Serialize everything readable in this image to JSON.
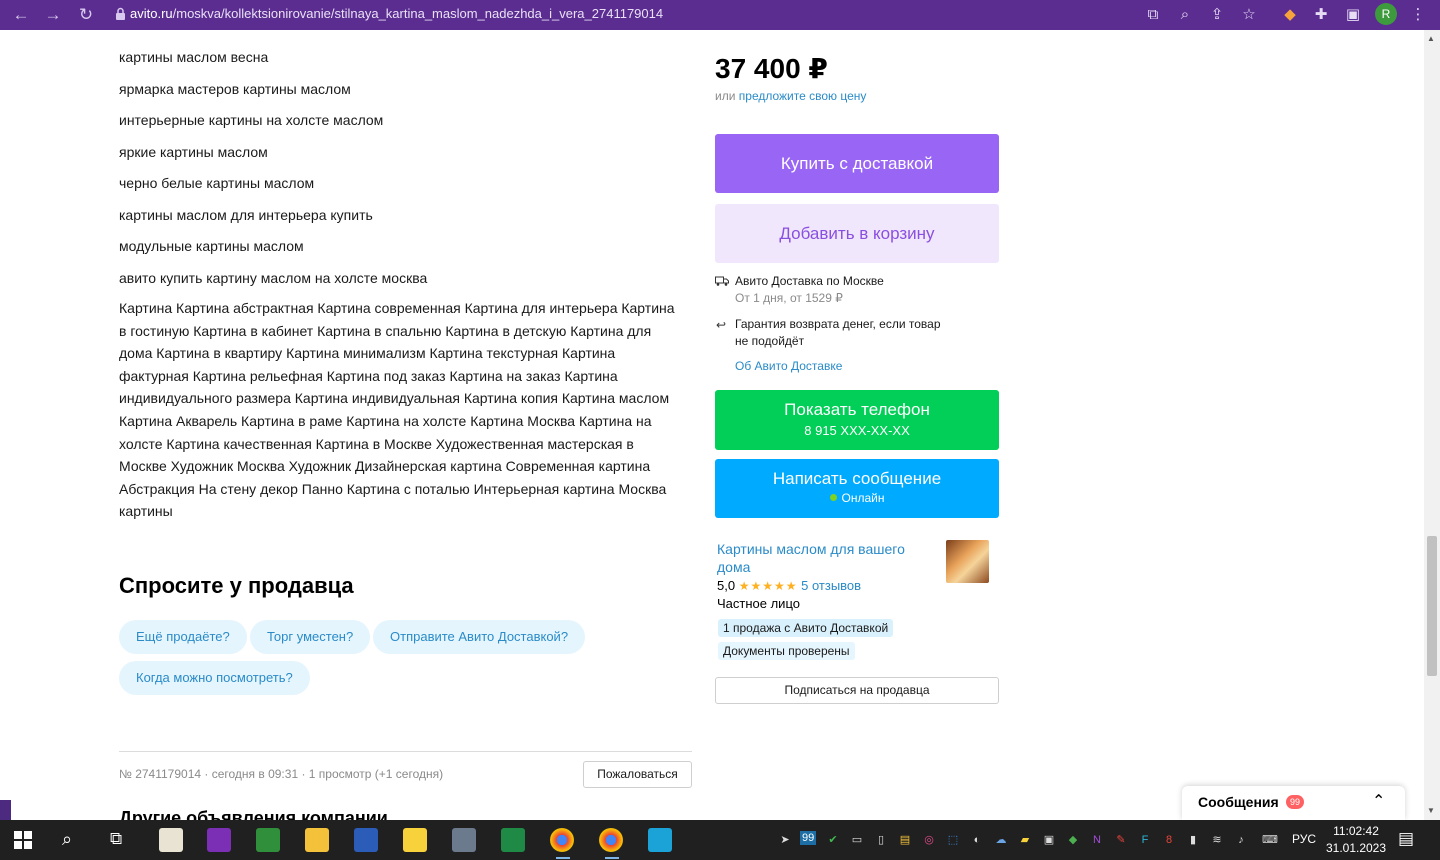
{
  "browser": {
    "url_host": "avito.ru",
    "url_path": "/moskva/kollektsionirovanie/stilnaya_kartina_maslom_nadezhda_i_vera_2741179014",
    "profile_initial": "R"
  },
  "tags": [
    "картины маслом весна",
    "ярмарка мастеров картины маслом",
    "интерьерные картины на холсте маслом",
    "яркие картины маслом",
    "черно белые картины маслом",
    "картины маслом для интерьера купить",
    "модульные картины маслом",
    "авито купить картину маслом на холсте москва"
  ],
  "description_lines": [
    "Картина Картина абстрактная Картина современная Картина для интерьера Картина",
    "в гостиную Картина в кабинет Картина в спальню Картина в детскую Картина для",
    "дома Картина в квартиру Картина минимализм Картина текстурная Картина",
    "фактурная Картина рельефная Картина под заказ Картина на заказ Картина",
    "индивидуального размера Картина индивидуальная Картина копия Картина маслом",
    "Картина Акварель Картина в раме Картина на холсте Картина Москва Картина на",
    "холсте Картина качественная Картина в Москве Художественная мастерская в",
    "Москве Художник Москва Художник Дизайнерская картина Современная картина",
    "Абстракция На стену декор Панно Картина с поталью Интерьерная картина Москва",
    "картины"
  ],
  "ask": {
    "title": "Спросите у продавца",
    "chips": [
      "Ещё продаёте?",
      "Торг уместен?",
      "Отправите Авито Доставкой?",
      "Когда можно посмотреть?"
    ]
  },
  "meta": {
    "text": "№ 2741179014 · сегодня в 09:31 · 1 просмотр (+1 сегодня)",
    "complain": "Пожаловаться"
  },
  "other_title": "Другие объявления компании",
  "sidebar": {
    "price": "37 400 ₽",
    "offer_prefix": "или",
    "offer_link": "предложите свою цену",
    "buy_label": "Купить с доставкой",
    "cart_label": "Добавить в корзину",
    "delivery_title": "Авито Доставка по Москве",
    "delivery_sub": "От 1 дня, от 1529 ₽",
    "guarantee_line1": "Гарантия возврата денег, если товар",
    "guarantee_line2": "не подойдёт",
    "about_delivery": "Об Авито Доставке",
    "phone_label": "Показать телефон",
    "phone_number": "8 915 XXX-XX-XX",
    "message_label": "Написать сообщение",
    "online": "Онлайн",
    "seller_name": "Картины маслом для вашего дома",
    "rating": "5,0",
    "stars": "★★★★★",
    "reviews": "5 отзывов",
    "seller_type": "Частное лицо",
    "badge_sales": "1 продажа с Авито Доставкой",
    "badge_docs": "Документы проверены",
    "subscribe": "Подписаться на продавца"
  },
  "messages_panel": {
    "title": "Сообщения",
    "count": "99"
  },
  "taskbar": {
    "tray_count": "99",
    "lang": "РУС",
    "time": "11:02:42",
    "date": "31.01.2023"
  },
  "colors": {
    "buy": "#9965f4",
    "cart_bg": "#f0e7fd",
    "phone": "#02cf58",
    "message": "#00aaff",
    "link": "#2a8bc8",
    "chrome": "#5b2d91"
  }
}
